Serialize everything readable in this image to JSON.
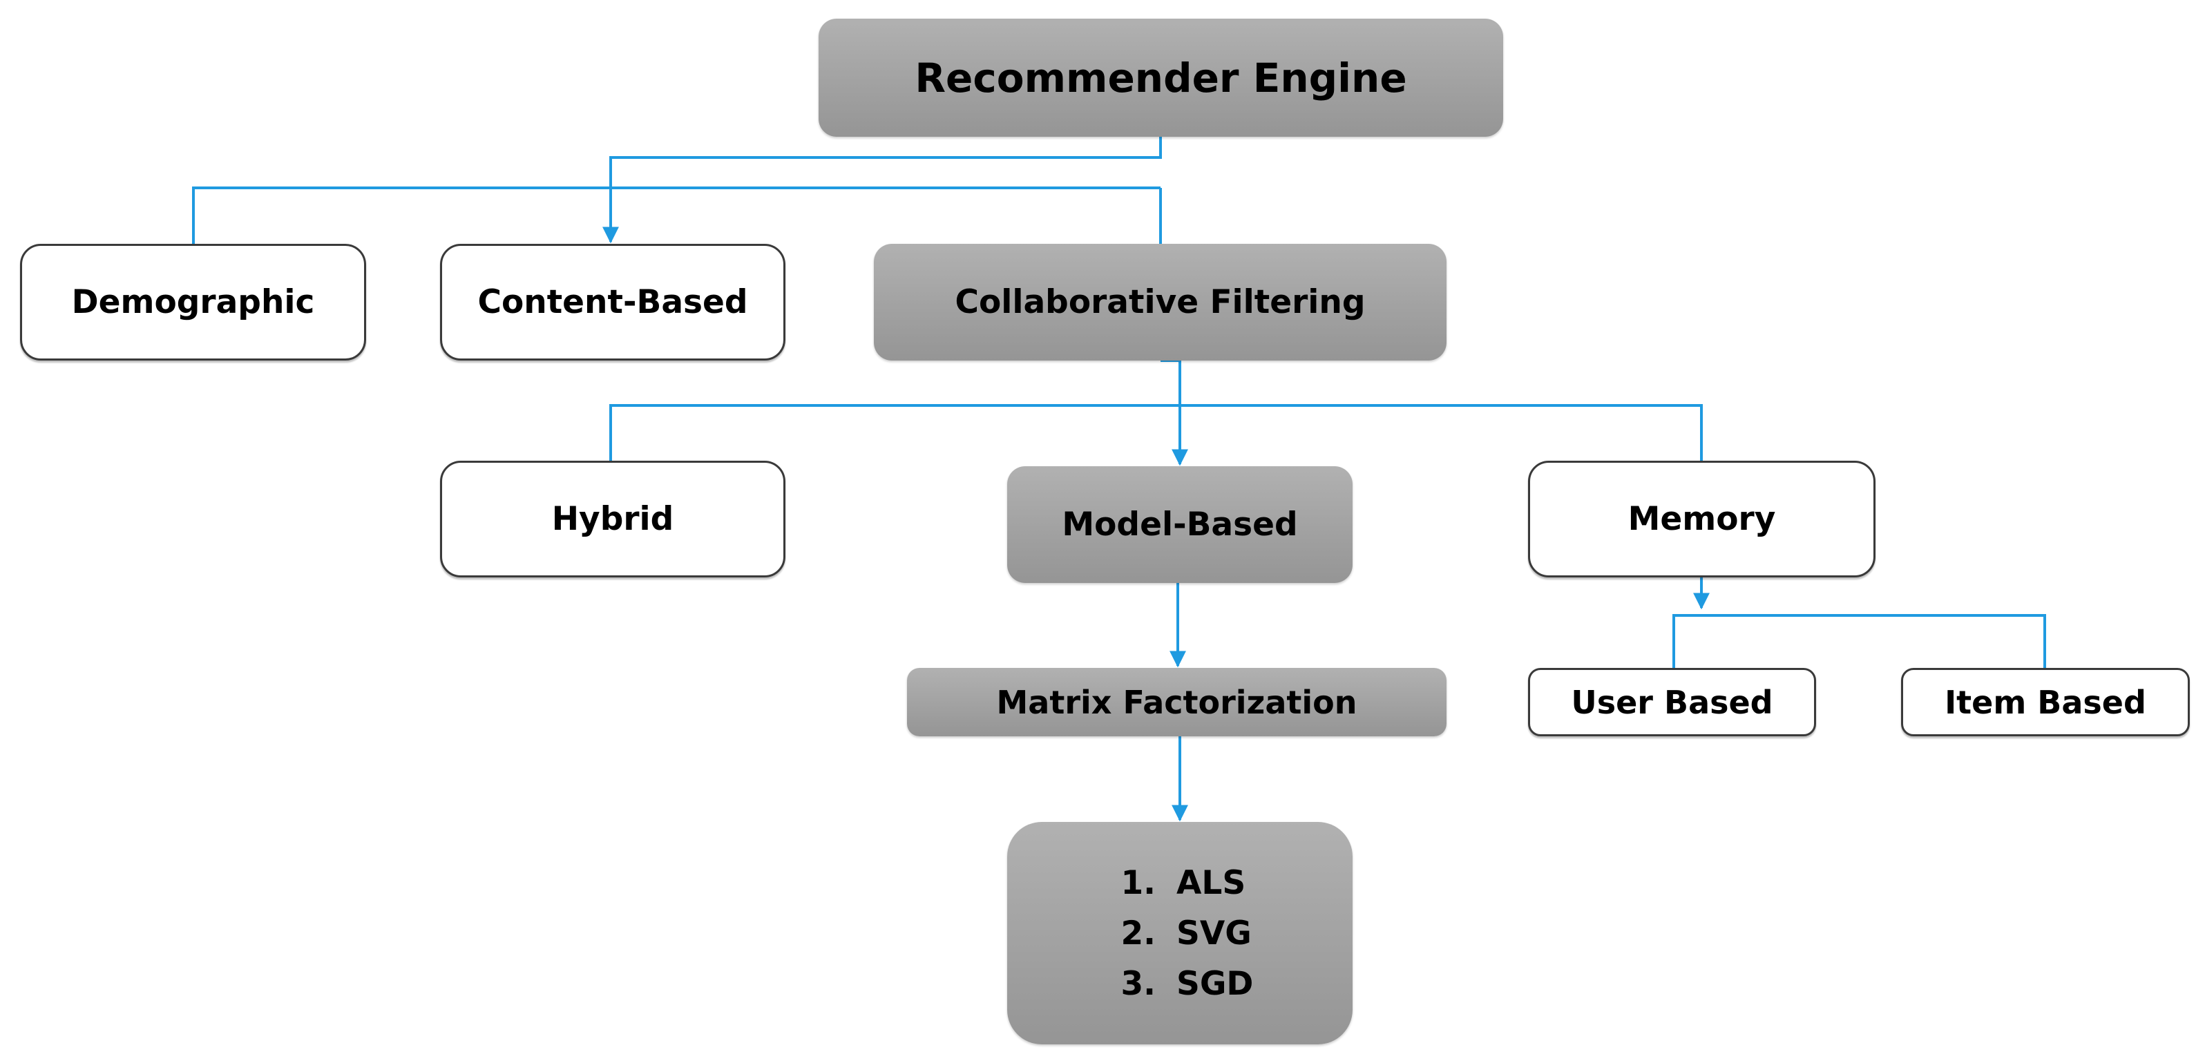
{
  "diagram": {
    "title": "Recommender Engine",
    "connector_color": "#1f9ae0",
    "nodes": {
      "root": "Recommender Engine",
      "demographic": "Demographic",
      "content_based": "Content-Based",
      "collaborative_filtering": "Collaborative Filtering",
      "hybrid": "Hybrid",
      "model_based": "Model-Based",
      "memory": "Memory",
      "matrix_factorization": "Matrix Factorization",
      "user_based": "User Based",
      "item_based": "Item Based"
    },
    "algorithms": [
      {
        "num": "1.",
        "name": "ALS"
      },
      {
        "num": "2.",
        "name": "SVG"
      },
      {
        "num": "3.",
        "name": "SGD"
      }
    ],
    "edges": [
      {
        "from": "Recommender Engine",
        "to": "Content-Based"
      },
      {
        "from": "Recommender Engine",
        "to": "Demographic"
      },
      {
        "from": "Recommender Engine",
        "to": "Collaborative Filtering"
      },
      {
        "from": "Collaborative Filtering",
        "to": "Model-Based"
      },
      {
        "from": "Collaborative Filtering",
        "to": "Hybrid"
      },
      {
        "from": "Collaborative Filtering",
        "to": "Memory"
      },
      {
        "from": "Model-Based",
        "to": "Matrix Factorization"
      },
      {
        "from": "Matrix Factorization",
        "to": "Algorithms list"
      },
      {
        "from": "Memory",
        "to": "User Based"
      },
      {
        "from": "Memory",
        "to": "Item Based"
      }
    ]
  }
}
